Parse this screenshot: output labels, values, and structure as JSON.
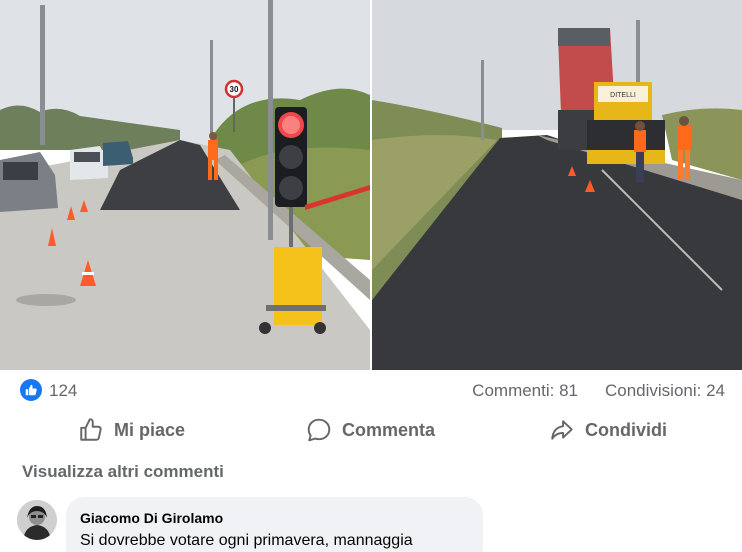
{
  "post": {
    "photos": [
      {
        "name": "left-photo",
        "signs": {
          "speed_limit": "30"
        }
      },
      {
        "name": "right-photo",
        "truck_brand": "DITELLI"
      }
    ],
    "reactions": {
      "like_count": "124",
      "icon": "thumbs-up-icon"
    },
    "comments_count_text": "Commenti: 81",
    "shares_count_text": "Condivisioni: 24",
    "actions": {
      "like_label": "Mi piace",
      "comment_label": "Commenta",
      "share_label": "Condividi"
    },
    "view_more_comments": "Visualizza altri commenti",
    "comment": {
      "author": "Giacomo Di Girolamo",
      "text": "Si dovrebbe votare ogni primavera, mannaggia"
    },
    "colors": {
      "facebook_blue": "#1877f2",
      "meta_text": "#65676b",
      "comment_bubble": "#f0f2f5"
    }
  }
}
